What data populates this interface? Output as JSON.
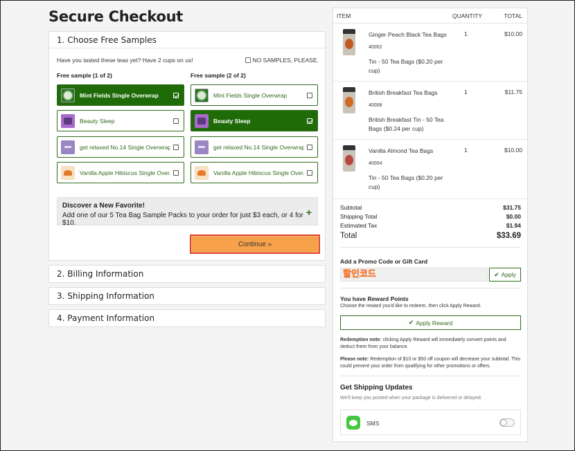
{
  "page_title": "Secure Checkout",
  "steps": {
    "step1": {
      "title": "1. Choose Free Samples",
      "prompt": "Have you tasted these teas yet? Have 2 cups on us!",
      "no_samples_label": "NO SAMPLES, PLEASE.",
      "col1_label": "Free sample (1 of 2)",
      "col2_label": "Free sample (2 of 2)",
      "col1": [
        {
          "label": "Mint Fields Single Overwrap",
          "selected": true
        },
        {
          "label": "Beauty Sleep",
          "selected": false
        },
        {
          "label": "get relaxed No.14 Single Overwrap",
          "selected": false
        },
        {
          "label": "Vanilla Apple Hibiscus Single Over...",
          "selected": false
        }
      ],
      "col2": [
        {
          "label": "Mint Fields Single Overwrap",
          "selected": false
        },
        {
          "label": "Beauty Sleep",
          "selected": true
        },
        {
          "label": "get relaxed No.14 Single Overwrap",
          "selected": false
        },
        {
          "label": "Vanilla Apple Hibiscus Single Over...",
          "selected": false
        }
      ],
      "discover_title": "Discover a New Favorite!",
      "discover_text": "Add one of our 5 Tea Bag Sample Packs to your order for just $3 each, or 4 for $10.",
      "discover_plus": "+",
      "continue_label": "Continue »"
    },
    "step2": "2. Billing Information",
    "step3": "3. Shipping Information",
    "step4": "4. Payment Information"
  },
  "cart": {
    "headers": {
      "item": "ITEM",
      "quantity": "QUANTITY",
      "total": "TOTAL"
    },
    "items": [
      {
        "name": "Ginger Peach Black Tea Bags",
        "sku": "40002",
        "desc": "Tin - 50 Tea Bags ($0.20 per cup)",
        "qty": "1",
        "price": "$10.00"
      },
      {
        "name": "British Breakfast Tea Bags",
        "sku": "40008",
        "desc": "British Breakfast Tin - 50 Tea Bags ($0.24 per cup)",
        "qty": "1",
        "price": "$11.75"
      },
      {
        "name": "Vanilla Almond Tea Bags",
        "sku": "40004",
        "desc": "Tin - 50 Tea Bags ($0.20 per cup)",
        "qty": "1",
        "price": "$10.00"
      }
    ],
    "totals": {
      "subtotal_label": "Subtotal",
      "subtotal": "$31.75",
      "shipping_label": "Shipping Total",
      "shipping": "$0.00",
      "tax_label": "Estimated Tax",
      "tax": "$1.94",
      "total_label": "Total",
      "total": "$33.69"
    },
    "promo": {
      "label": "Add a Promo Code or Gift Card",
      "value": "할인코드",
      "apply_label": "Apply"
    },
    "reward": {
      "title": "You have Reward Points",
      "subtitle": "Choose the reward you'd like to redeem, then click Apply Reward.",
      "button_label": "Apply Reward",
      "note1_bold": "Redemption note:",
      "note1": " clicking Apply Reward will immediately convert points and deduct them from your balance.",
      "note2_bold": "Please note:",
      "note2": " Redemption of $10 or $50 off coupon will decrease your subtotal. This could prevent your order from qualifying for other promotions or offers."
    },
    "shipping_updates": {
      "title": "Get Shipping Updates",
      "subtitle": "We'll keep you posted when your package is delivered or delayed.",
      "sms_label": "SMS",
      "sms_enabled": false
    }
  },
  "colors": {
    "brand_green": "#1f6b08",
    "continue_orange": "#f7a24a",
    "promo_text": "#ff7a1a"
  }
}
